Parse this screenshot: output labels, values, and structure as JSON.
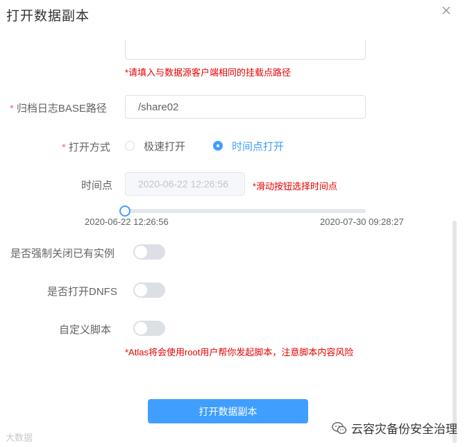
{
  "dialog": {
    "title": "打开数据副本",
    "close_icon": "close-icon"
  },
  "mount_hint": "*请填入与数据源客户端相同的挂载点路径",
  "archive_log": {
    "required_mark": "*",
    "label": "归档日志BASE路径",
    "value": "/share02"
  },
  "open_mode": {
    "required_mark": "*",
    "label": "打开方式",
    "options": [
      {
        "label": "极速打开",
        "checked": false
      },
      {
        "label": "时间点打开",
        "checked": true
      }
    ]
  },
  "time_point": {
    "label": "时间点",
    "value": "2020-06-22 12:26:56",
    "hint": "*滑动按钮选择时间点",
    "slider": {
      "min_label": "2020-06-22 12:26:56",
      "max_label": "2020-07-30 09:28:27",
      "position": 0
    }
  },
  "force_close": {
    "label": "是否强制关闭已有实例",
    "on": false
  },
  "open_dnfs": {
    "label": "是否打开DNFS",
    "on": false
  },
  "custom_script": {
    "label": "自定义脚本",
    "on": false,
    "hint": "*Atlas将会使用root用户帮你发起脚本，注意脚本内容风险"
  },
  "submit_label": "打开数据副本",
  "watermarks": {
    "left": "大数据",
    "right": "云容灾备份安全治理",
    "right_icon": "wechat-icon"
  },
  "colors": {
    "primary": "#409eff",
    "danger": "#e60000",
    "required": "#f56c6c"
  }
}
